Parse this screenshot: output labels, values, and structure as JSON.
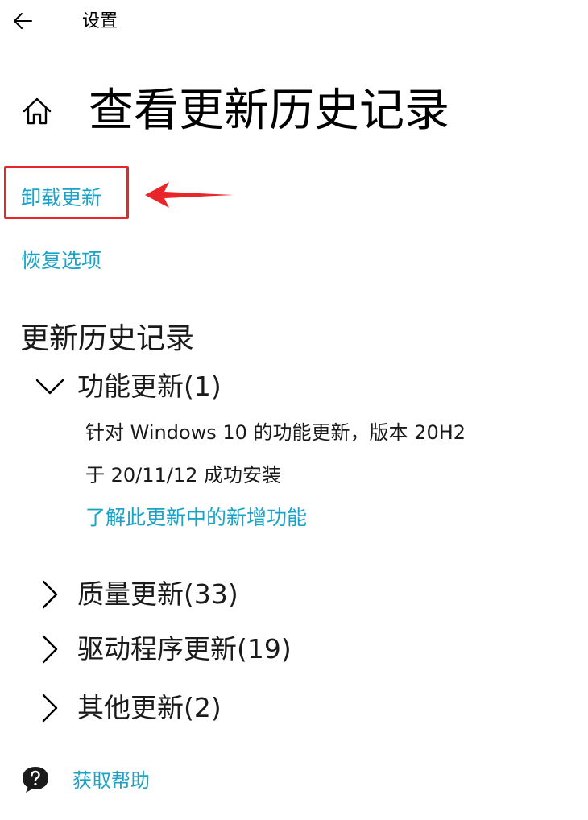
{
  "window": {
    "title": "设置"
  },
  "header": {
    "page_title": "查看更新历史记录"
  },
  "links": {
    "uninstall": "卸载更新",
    "recovery": "恢复选项"
  },
  "history": {
    "heading": "更新历史记录",
    "categories": [
      {
        "label": "功能更新(1)",
        "expanded": true,
        "icon": "chevron-down-icon"
      },
      {
        "label": "质量更新(33)",
        "expanded": false,
        "icon": "chevron-right-icon"
      },
      {
        "label": "驱动程序更新(19)",
        "expanded": false,
        "icon": "chevron-right-icon"
      },
      {
        "label": "其他更新(2)",
        "expanded": false,
        "icon": "chevron-right-icon"
      }
    ],
    "feature_update": {
      "name": "针对 Windows 10 的功能更新，版本 20H2",
      "status": "于 20/11/12 成功安装",
      "learn_more": "了解此更新中的新增功能"
    }
  },
  "help": {
    "label": "获取帮助"
  },
  "icons": {
    "back": "back-arrow-icon",
    "home": "home-icon",
    "help": "help-chat-icon",
    "annotation": "red-arrow-icon"
  },
  "colors": {
    "link": "#1aa3c7",
    "annotation": "#e8262a",
    "text": "#000000",
    "background": "#ffffff"
  }
}
